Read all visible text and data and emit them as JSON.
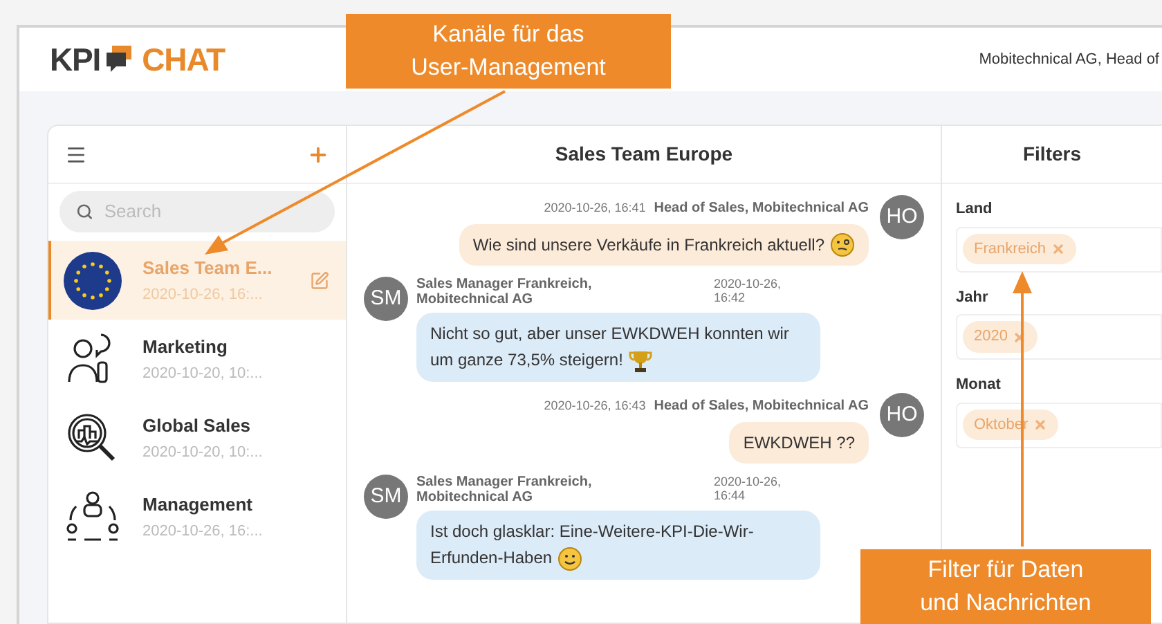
{
  "header": {
    "logo_left": "KPI",
    "logo_right": "CHAT",
    "user": "Mobitechnical AG, Head of"
  },
  "sidebar": {
    "search": {
      "placeholder": "Search"
    },
    "channels": [
      {
        "kind": "flag",
        "name": "Sales Team E...",
        "time": "2020-10-26, 16:...",
        "selected": true
      },
      {
        "kind": "person",
        "name": "Marketing",
        "time": "2020-10-20, 10:...",
        "selected": false
      },
      {
        "kind": "magnifier",
        "name": "Global Sales",
        "time": "2020-10-20, 10:...",
        "selected": false
      },
      {
        "kind": "team",
        "name": "Management",
        "time": "2020-10-26, 16:...",
        "selected": false
      }
    ]
  },
  "chat": {
    "title": "Sales Team Europe",
    "messages": [
      {
        "kind": "outgoing",
        "avatar": "HO",
        "time": "2020-10-26, 16:41",
        "sender": "Head of Sales, Mobitechnical AG",
        "text": "Wie sind unsere Verkäufe in Frankreich aktuell?"
      },
      {
        "kind": "incoming",
        "avatar": "SM",
        "time": "2020-10-26, 16:42",
        "sender": "Sales Manager Frankreich, Mobitechnical AG",
        "text": "Nicht so gut, aber unser EWKDWEH konnten wir um ganze 73,5% steigern!"
      },
      {
        "kind": "outgoing",
        "avatar": "HO",
        "time": "2020-10-26, 16:43",
        "sender": "Head of Sales, Mobitechnical AG",
        "text": "EWKDWEH ??"
      },
      {
        "kind": "incoming",
        "avatar": "SM",
        "time": "2020-10-26, 16:44",
        "sender": "Sales Manager Frankreich, Mobitechnical AG",
        "text": "Ist doch glasklar: Eine-Weitere-KPI-Die-Wir-Erfunden-Haben"
      }
    ]
  },
  "filters": {
    "title": "Filters",
    "groups": [
      {
        "label": "Land",
        "chips": [
          "Frankreich"
        ]
      },
      {
        "label": "Jahr",
        "chips": [
          "2020"
        ]
      },
      {
        "label": "Monat",
        "chips": [
          "Oktober"
        ]
      }
    ]
  },
  "annotations": [
    {
      "text": "Kanäle für das User-Management"
    },
    {
      "text": "Filter für Daten und Nachrichten"
    }
  ]
}
